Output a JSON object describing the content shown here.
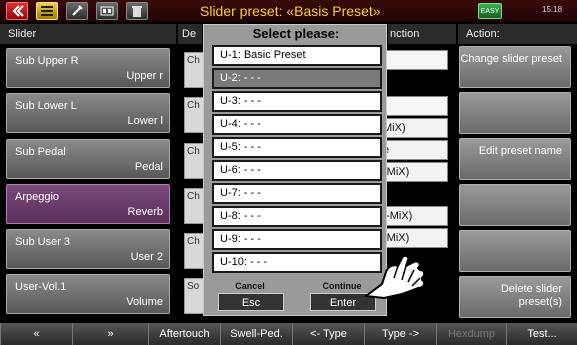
{
  "top_bar": {
    "title": "Slider preset: «Basis Preset»",
    "icons": [
      "close-icon",
      "menu-icon",
      "tools-icon",
      "registration-icon",
      "trash-icon"
    ],
    "ecomic_label": "EASY",
    "clock": "15:18"
  },
  "headers": {
    "slider": "Slider",
    "destination": "De",
    "function": "nction",
    "action": "Action:"
  },
  "sliders": [
    {
      "name": "Sub Upper R",
      "dest": "Upper r"
    },
    {
      "name": "Sub Lower L",
      "dest": "Lower l"
    },
    {
      "name": "Sub Pedal",
      "dest": "Pedal"
    },
    {
      "name": "Arpeggio",
      "dest": "Reverb"
    },
    {
      "name": "Sub User 3",
      "dest": "User 2"
    },
    {
      "name": "User-Vol.1",
      "dest": "Volume"
    }
  ],
  "stubs": [
    "Ch",
    "Ch",
    "Ch",
    "Ch",
    "Ch",
    "So"
  ],
  "functions": [
    "",
    "",
    "MiX)",
    "e",
    "-MiX)",
    ".-MiX)",
    "-MiX)"
  ],
  "actions": [
    "Change slider preset",
    "",
    "Edit preset name",
    "",
    "",
    "Delete slider preset(s)"
  ],
  "dialog": {
    "title": "Select please:",
    "items": [
      "U-1: Basic Preset",
      "U-2: - - -",
      "U-3: - - -",
      "U-4: - - -",
      "U-5: - - -",
      "U-6: - - -",
      "U-7: - - -",
      "U-8: - - -",
      "U-9: - - -",
      "U-10: - - -"
    ],
    "selected_index": 1,
    "cancel_label": "Cancel",
    "cancel_button": "Esc",
    "continue_label": "Continue",
    "continue_button": "Enter"
  },
  "bottom_bar": [
    "«",
    "»",
    "Aftertouch",
    "Swell-Ped.",
    "<- Type",
    "Type ->",
    "Hexdump",
    "Test..."
  ],
  "colors": {
    "title": "#f7d23a",
    "active_slider": "#6a3a6a"
  }
}
